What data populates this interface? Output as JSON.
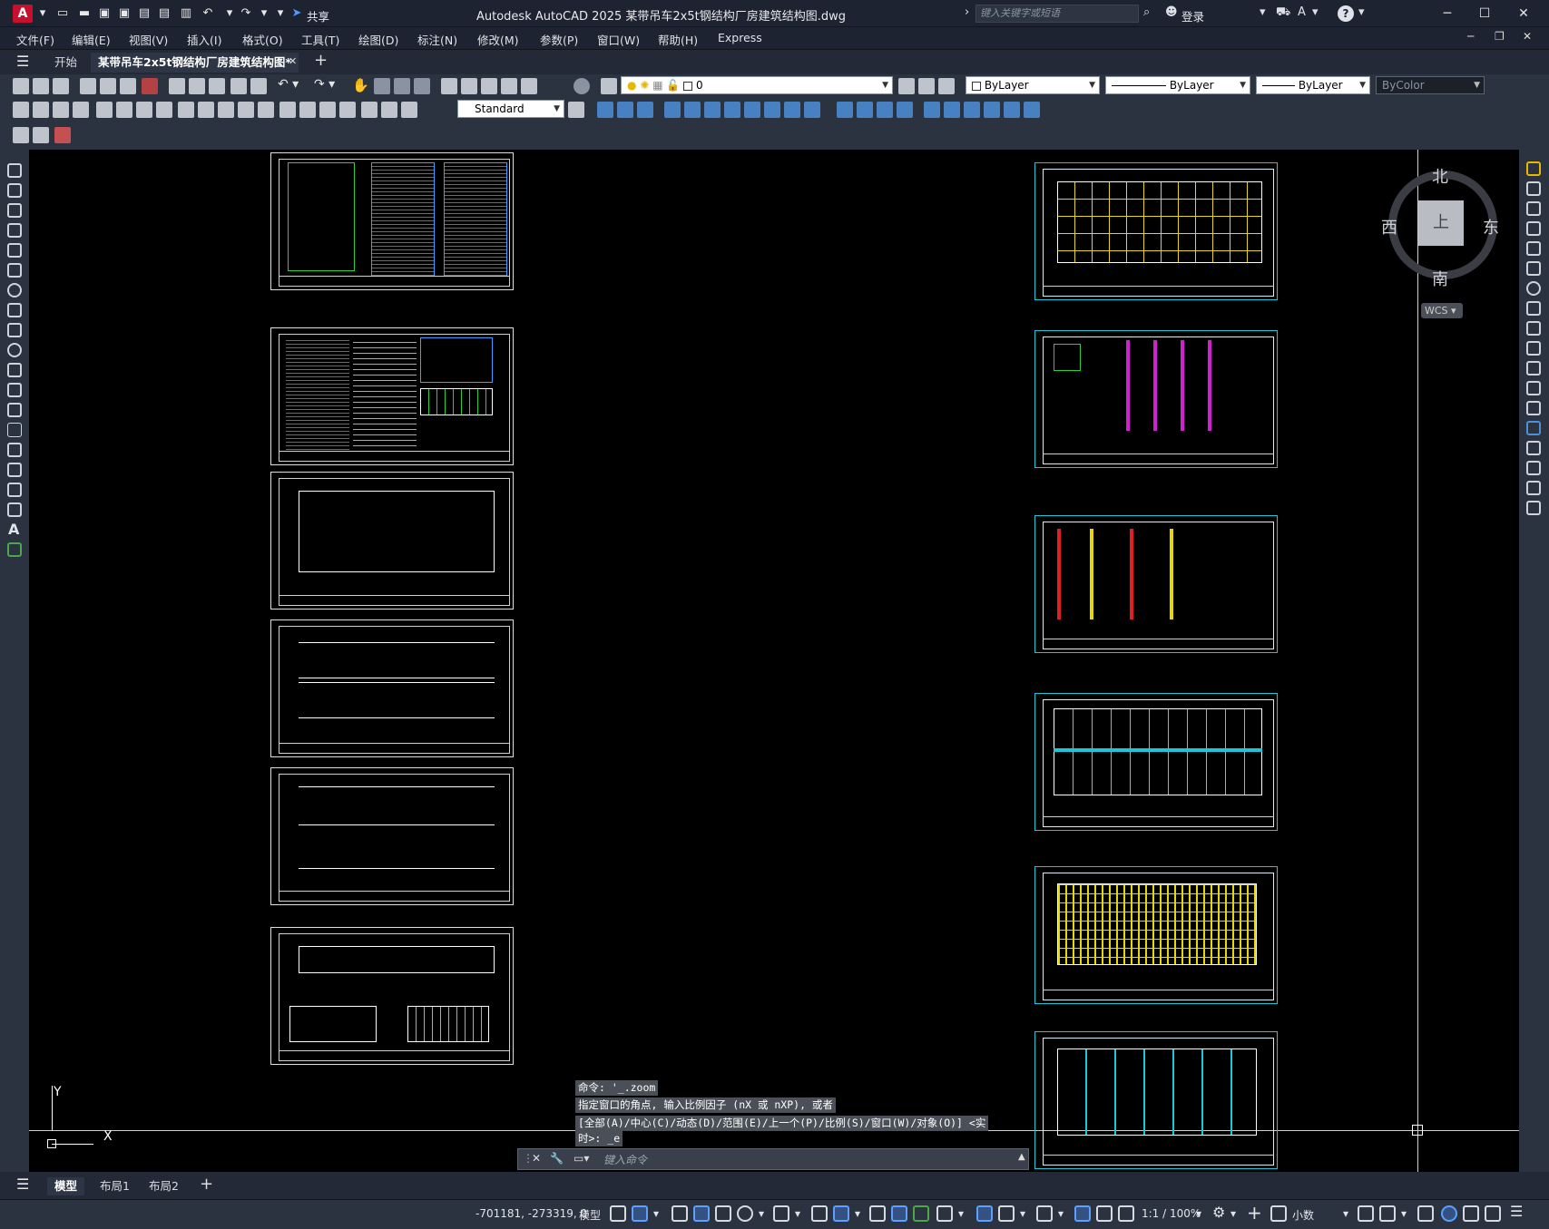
{
  "app": {
    "logo": "A",
    "title": "Autodesk AutoCAD 2025    某带吊车2x5t钢结构厂房建筑结构图.dwg",
    "share_label": "共享",
    "search_placeholder": "键入关键字或短语",
    "login_label": "登录",
    "help_label": "?"
  },
  "menu": [
    "文件(F)",
    "编辑(E)",
    "视图(V)",
    "插入(I)",
    "格式(O)",
    "工具(T)",
    "绘图(D)",
    "标注(N)",
    "修改(M)",
    "参数(P)",
    "窗口(W)",
    "帮助(H)",
    "Express"
  ],
  "tabs": {
    "start": "开始",
    "active": "某带吊车2x5t钢结构厂房建筑结构图*",
    "close": "✕",
    "add": "+"
  },
  "toolbar": {
    "layer_value": "0",
    "color_value": "ByLayer",
    "linetype_value": "ByLayer",
    "lineweight_value": "ByLayer",
    "plotstyle_value": "ByColor",
    "textstyle_value": "Standard"
  },
  "viewcube": {
    "north": "北",
    "south": "南",
    "east": "东",
    "west": "西",
    "top_face": "上",
    "wcs": "WCS"
  },
  "ucs": {
    "x": "X",
    "y": "Y"
  },
  "command": {
    "history": [
      "命令: '_.zoom",
      "指定窗口的角点, 输入比例因子 (nX 或 nXP), 或者",
      "[全部(A)/中心(C)/动态(D)/范围(E)/上一个(P)/比例(S)/窗口(W)/对象(O)] <实",
      "时>: _e"
    ],
    "placeholder": "键入命令"
  },
  "layout_tabs": [
    "模型",
    "布局1",
    "布局2"
  ],
  "status": {
    "coords": "-701181, -273319, 0",
    "model": "模型",
    "scale": "1:1 / 100%",
    "units": "小数"
  }
}
